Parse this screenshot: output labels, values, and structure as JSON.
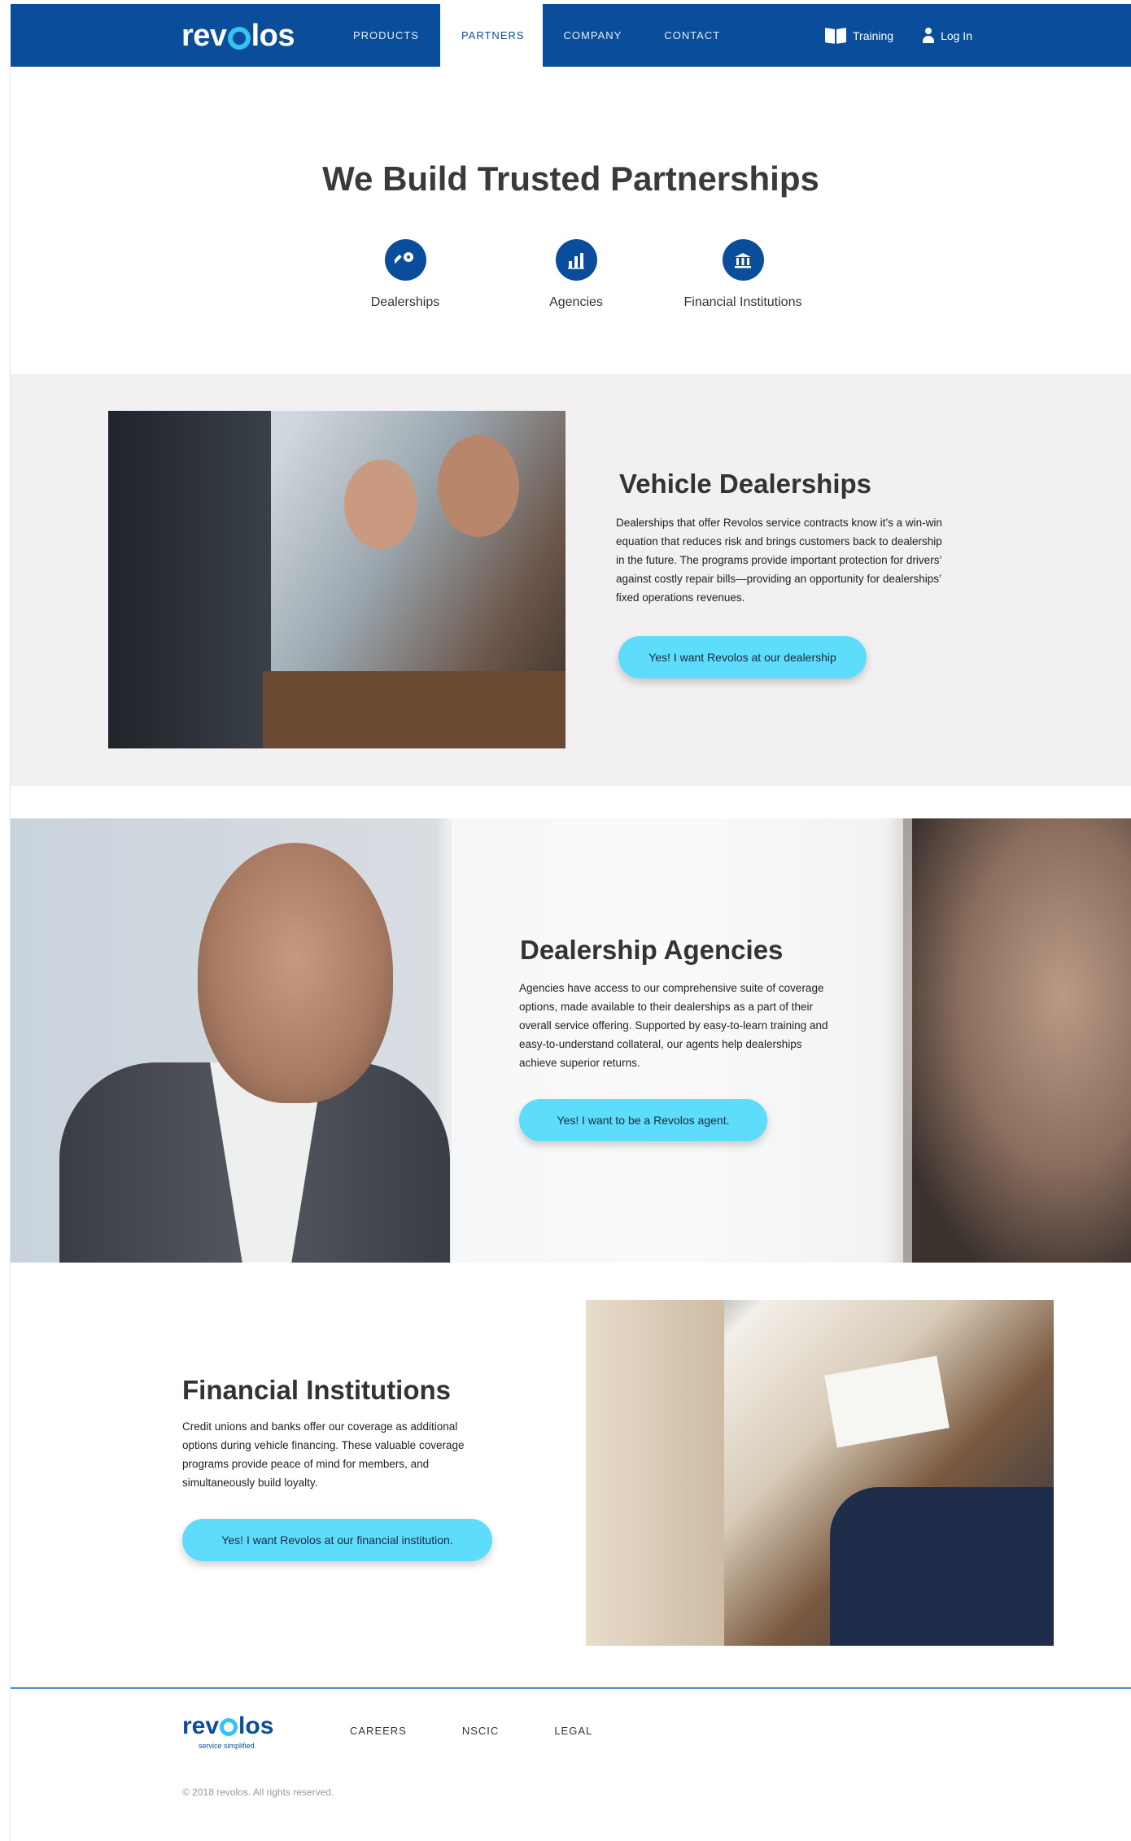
{
  "brand": {
    "logo_pre": "rev",
    "logo_post": "los",
    "tagline": "service simplified."
  },
  "nav": {
    "links": [
      "PRODUCTS",
      "PARTNERS",
      "COMPANY",
      "CONTACT"
    ],
    "active": "PARTNERS",
    "training": "Training",
    "login": "Log In"
  },
  "hero": {
    "title": "We Build Trusted Partnerships",
    "types": [
      {
        "label": "Dealerships",
        "icon": "key-icon"
      },
      {
        "label": "Agencies",
        "icon": "bar-chart-icon"
      },
      {
        "label": "Financial Institutions",
        "icon": "bank-icon"
      }
    ]
  },
  "dealerships": {
    "title": "Vehicle Dealerships",
    "body": "Dealerships that offer Revolos service contracts know it’s a win-win equation that reduces risk and brings customers back to dealership in the future. The programs provide important protection for drivers’ against costly repair bills—providing an opportunity for dealerships’ fixed operations revenues.",
    "cta": "Yes! I want Revolos at our dealership"
  },
  "agencies": {
    "title": "Dealership Agencies",
    "body": "Agencies have access to our comprehensive suite of coverage options, made available to their dealerships as a part of their overall service offering. Supported by easy-to-learn training and easy-to-understand collateral, our agents help dealerships achieve superior returns.",
    "cta": "Yes! I want to be a Revolos agent."
  },
  "financial": {
    "title": "Financial Institutions",
    "body": "Credit unions and banks offer our coverage as additional options during vehicle financing. These valuable coverage programs provide peace of mind for members, and simultaneously build loyalty.",
    "cta": "Yes! I want Revolos at our financial institution."
  },
  "footer": {
    "links": [
      "CAREERS",
      "NSCIC",
      "LEGAL"
    ],
    "copyright": "© 2018 revolos. All rights reserved."
  },
  "colors": {
    "brand_blue": "#0a4d9b",
    "accent_cyan": "#5ddcfb",
    "gear_cyan": "#34c4f0",
    "section_gray": "#f2f0f0"
  }
}
